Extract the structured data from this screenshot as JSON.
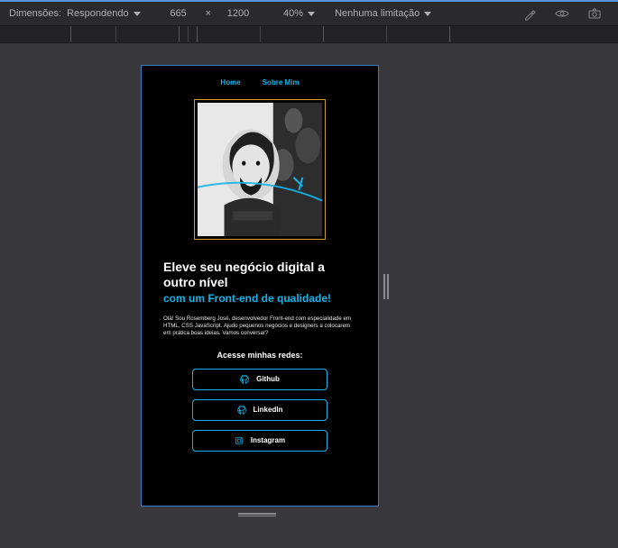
{
  "toolbar": {
    "dimensions_label": "Dimensões:",
    "preset": "Respondendo",
    "width": "665",
    "height": "1200",
    "zoom": "40%",
    "throttling": "Nenhuma limitação"
  },
  "page": {
    "nav": {
      "home": "Home",
      "about": "Sobre Mim"
    },
    "headline": "Eleve seu negócio digital a outro nível",
    "subhead": "com um Front-end de qualidade!",
    "intro": "Olá! Sou Rosemberg José, desenvolvedor Front-end com especialidade em HTML, CSS JavaScript. Ajudo pequenos negócios e designers a colocarem em prática boas ideias. Vamos conversar?",
    "social_title": "Acesse minhas redes:",
    "socials": {
      "github": "Github",
      "linkedin": "LinkedIn",
      "instagram": "Instagram"
    }
  }
}
